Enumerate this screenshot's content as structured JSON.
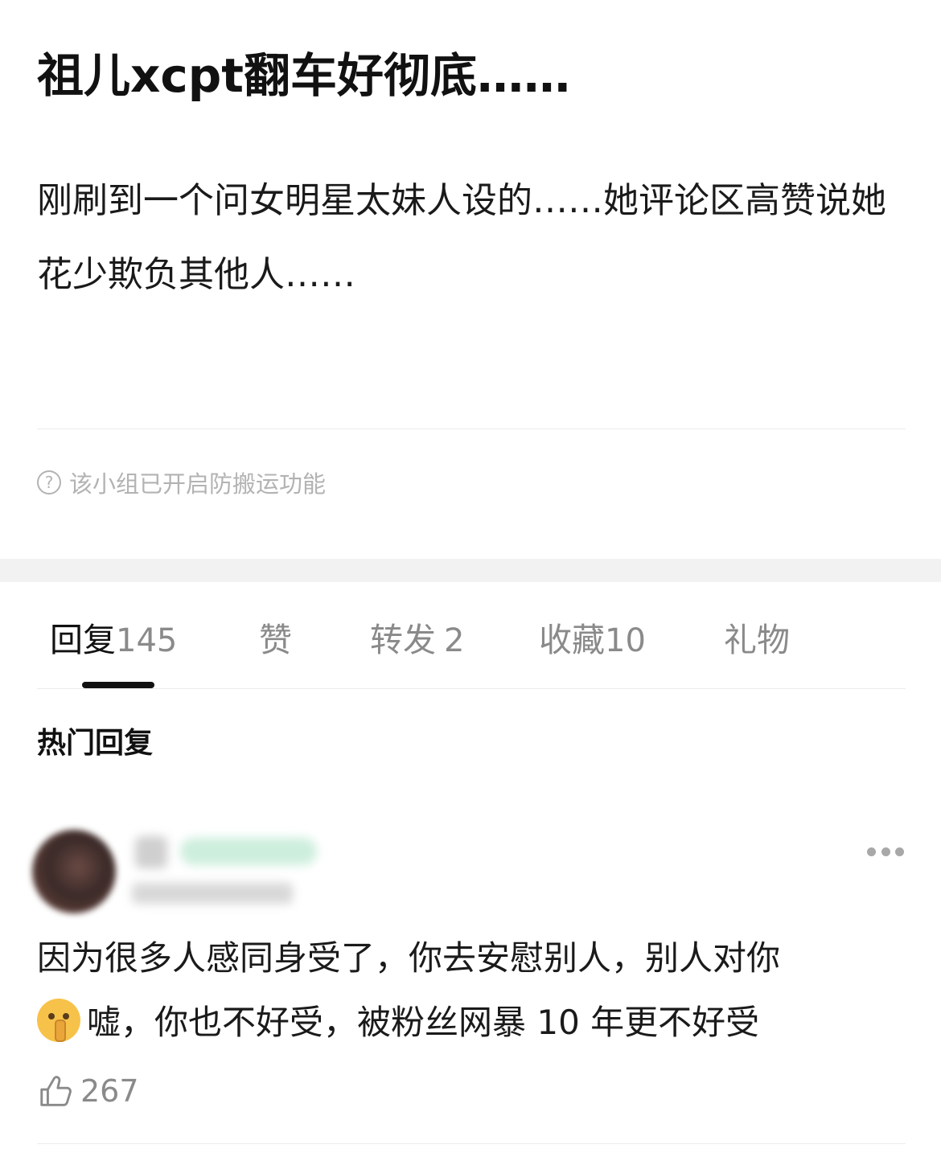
{
  "post": {
    "title": "祖儿xcpt翻车好彻底……",
    "body": "刚刷到一个问女明星太妹人设的……她评论区高赞说她花少欺负其他人……",
    "notice": "该小组已开启防搬运功能"
  },
  "tabs": [
    {
      "label": "回复",
      "count": "145",
      "active": true
    },
    {
      "label": "赞",
      "count": ""
    },
    {
      "label": "转发",
      "count": "2"
    },
    {
      "label": "收藏",
      "count": "10"
    },
    {
      "label": "礼物",
      "count": ""
    }
  ],
  "section": {
    "title": "热门回复"
  },
  "comment": {
    "text_line1": "因为很多人感同身受了，你去安慰别人，别人对你",
    "text_line2": "嘘，你也不好受，被粉丝网暴 10 年更不好受",
    "emoji": "shushing-face",
    "likes": "267"
  },
  "icons": {
    "notice": "question-circle-icon",
    "more": "more-dots-icon",
    "like": "thumbs-up-icon"
  }
}
